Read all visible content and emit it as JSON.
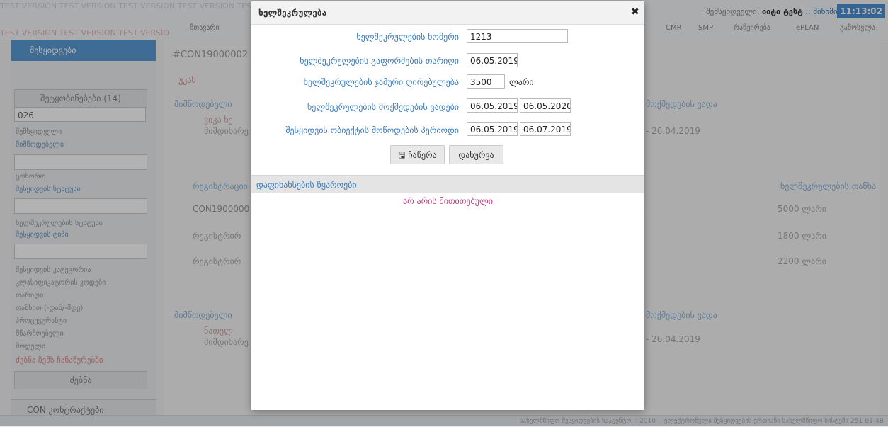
{
  "header": {
    "user_label": "შემსყიდველი:",
    "user_name": "იიტი ტესტ",
    "user_role": ":: მინიმინი",
    "clock": "11:13:02",
    "watermark": "TEST VERSION  TEST VERSION  TEST VERSION  TEST VERSION  TEST VERSION  TEST VERSION  TEST VERSION"
  },
  "nav": {
    "items": [
      "მთავარი",
      "CMR",
      "SMP",
      "რანჟირება",
      "ePLAN",
      "გამოსვლა"
    ]
  },
  "sidebar": {
    "title": "შესყიდვები",
    "messages_btn": "შეტყობინებები (14)",
    "search_value": "026",
    "filters": [
      "შემსყიდველი",
      "მიმწოდებელი",
      "ცოხორო",
      "შესყიდვის სტატუსი",
      "ხელშეკრულების სტატუსი",
      "შესყიდვის ტიპი",
      "შესყიდვის კატეგორია",
      "კლასიფიკატორის კოდები",
      "თარიღი",
      "თანხით (-დან/-მდე)",
      "პროცეჭურანტი",
      "მწარმოებელი",
      "მოდელი"
    ],
    "my_records": "ძებნა ჩემს ჩანაწერებში",
    "search_btn": "ძებნა",
    "con_label": "CON კონტრაქტები"
  },
  "background": {
    "con_number": "#CON19000002",
    "back_label": "უკან",
    "supplier_header": "მიმწოდებელი",
    "validity_header": "მოქმედების ვადა",
    "date_range": "- 26.04.2019",
    "registration_header": "რეგისტრაციი",
    "contract_amount_header": "ხელშეკრულების თანხა",
    "row_con": "CON1900000",
    "row_reg1": "რეგისტრირ",
    "row_reg2": "რეგისტრირ",
    "amounts": [
      "5000 ლარი",
      "1800 ლარი",
      "2200 ლარი"
    ],
    "supplier_name_1": "ვიკა ხე",
    "supplier_name_2": "ნათელ",
    "supplier_sub": "მიმდინარე"
  },
  "modal": {
    "title": "ხელშეკრულება",
    "fields": {
      "number": {
        "label": "ხელშეკრულების ნომერი",
        "value": "1213"
      },
      "sign_date": {
        "label": "ხელშეკრულების გაფორმების თარიღი",
        "value": "06.05.2019"
      },
      "total_value": {
        "label": "ხელშეკრულების ჯამური ღირებულება",
        "value": "3500",
        "unit": "ლარი"
      },
      "validity": {
        "label": "ხელშეკრულების მოქმედების ვადები",
        "from": "06.05.2019",
        "to": "06.05.2020"
      },
      "delivery": {
        "label": "შესყიდვის ობიექტის მოწოდების პერიოდი",
        "from": "06.05.2019",
        "to": "06.07.2019"
      }
    },
    "save_label": "ჩაწერა",
    "close_label": "დახურვა",
    "funding": {
      "title": "დაფინანსების წყაროები",
      "empty_text": "არ არის მითითებული"
    }
  },
  "footer": {
    "text": "სახელმწიფო შესყიდვების სააგენტო :: 2010 :: ელექტრონული შესყიდვების ერთიანი სახელმწიფო სისტემა 251-01-4B"
  },
  "colors": {
    "accent": "#3a7ebf",
    "danger": "#d63384",
    "clock_bg": "#4d8fd1",
    "sidebar_head": "#5a9bd5"
  }
}
